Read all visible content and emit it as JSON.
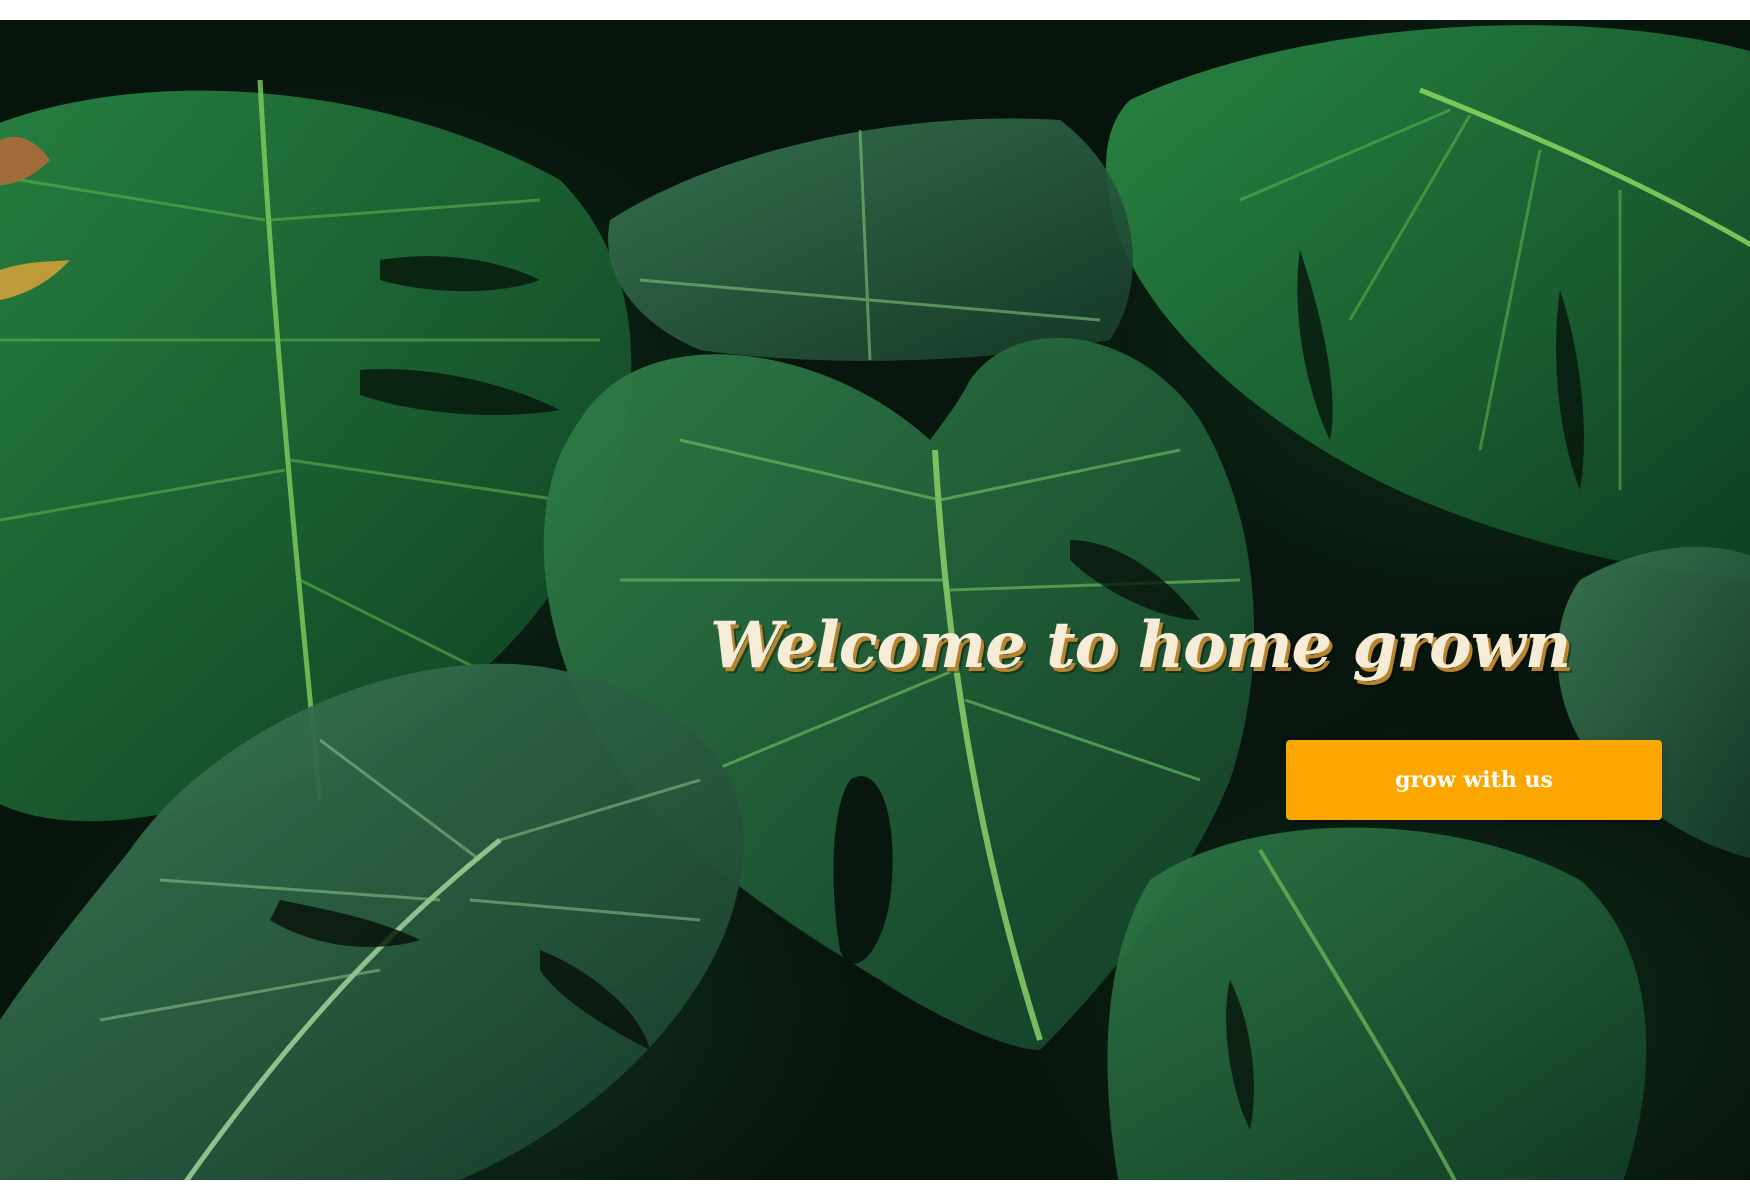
{
  "hero": {
    "title": "Welcome to home  grown",
    "cta_label": "grow with us",
    "background_image": "monstera-leaves-photo"
  },
  "colors": {
    "cta_background": "#fca600",
    "cta_text": "#ffffff",
    "title_text": "#f6ecd8",
    "title_shadow": "#b8852d",
    "leaf_dark": "#0f3d24",
    "leaf_mid": "#1e6b3a",
    "leaf_vein": "#6fbf5a",
    "backdrop": "#07140c"
  }
}
